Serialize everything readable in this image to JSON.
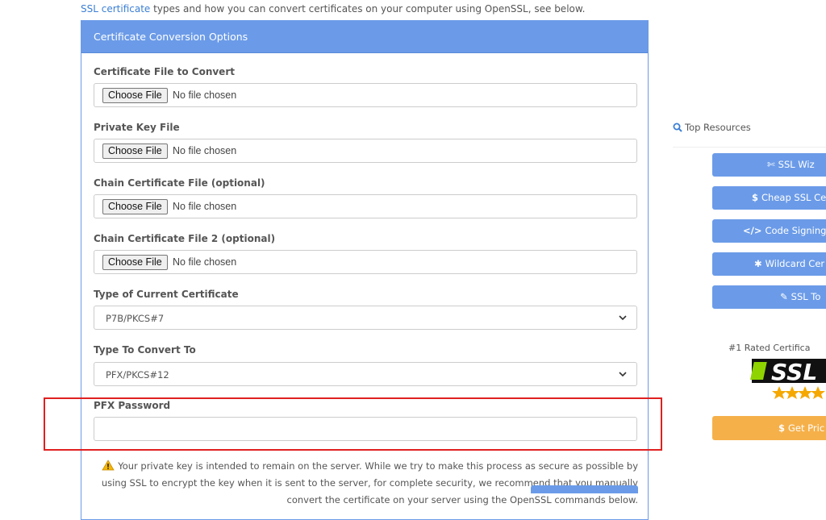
{
  "intro": {
    "link_text": "SSL certificate",
    "rest_text": " types and how you can convert certificates on your computer using OpenSSL, see below."
  },
  "panel": {
    "title": "Certificate Conversion Options",
    "fields": [
      {
        "label": "Certificate File to Convert",
        "button": "Choose File",
        "status": "No file chosen"
      },
      {
        "label": "Private Key File",
        "button": "Choose File",
        "status": "No file chosen"
      },
      {
        "label": "Chain Certificate File (optional)",
        "button": "Choose File",
        "status": "No file chosen"
      },
      {
        "label": "Chain Certificate File 2 (optional)",
        "button": "Choose File",
        "status": "No file chosen"
      }
    ],
    "current_type": {
      "label": "Type of Current Certificate",
      "value": "P7B/PKCS#7"
    },
    "convert_to": {
      "label": "Type To Convert To",
      "value": "PFX/PKCS#12"
    },
    "pfx_password": {
      "label": "PFX Password",
      "value": ""
    },
    "warning_text": "Your private key is intended to remain on the server. While we try to make this process as secure as possible by using SSL to encrypt the key when it is sent to the server, for complete security, we recommend that you manually convert the certificate on your server using the OpenSSL commands below."
  },
  "sidebar": {
    "title": "Top Resources",
    "buttons": [
      {
        "icon": "magic-wand-icon",
        "label": "SSL Wiz"
      },
      {
        "icon": "dollar-icon",
        "label": "Cheap SSL Cer"
      },
      {
        "icon": "code-icon",
        "label": "Code Signing C"
      },
      {
        "icon": "asterisk-icon",
        "label": "Wildcard Cer"
      },
      {
        "icon": "wrench-icon",
        "label": "SSL To"
      }
    ],
    "rated_text": "#1 Rated Certifica",
    "logo_text": "SSL",
    "price_button": "Get Pric"
  },
  "colors": {
    "accent": "#6b9be8",
    "price": "#f5b04a",
    "highlight": "#e02020",
    "link": "#3b7fd5"
  }
}
